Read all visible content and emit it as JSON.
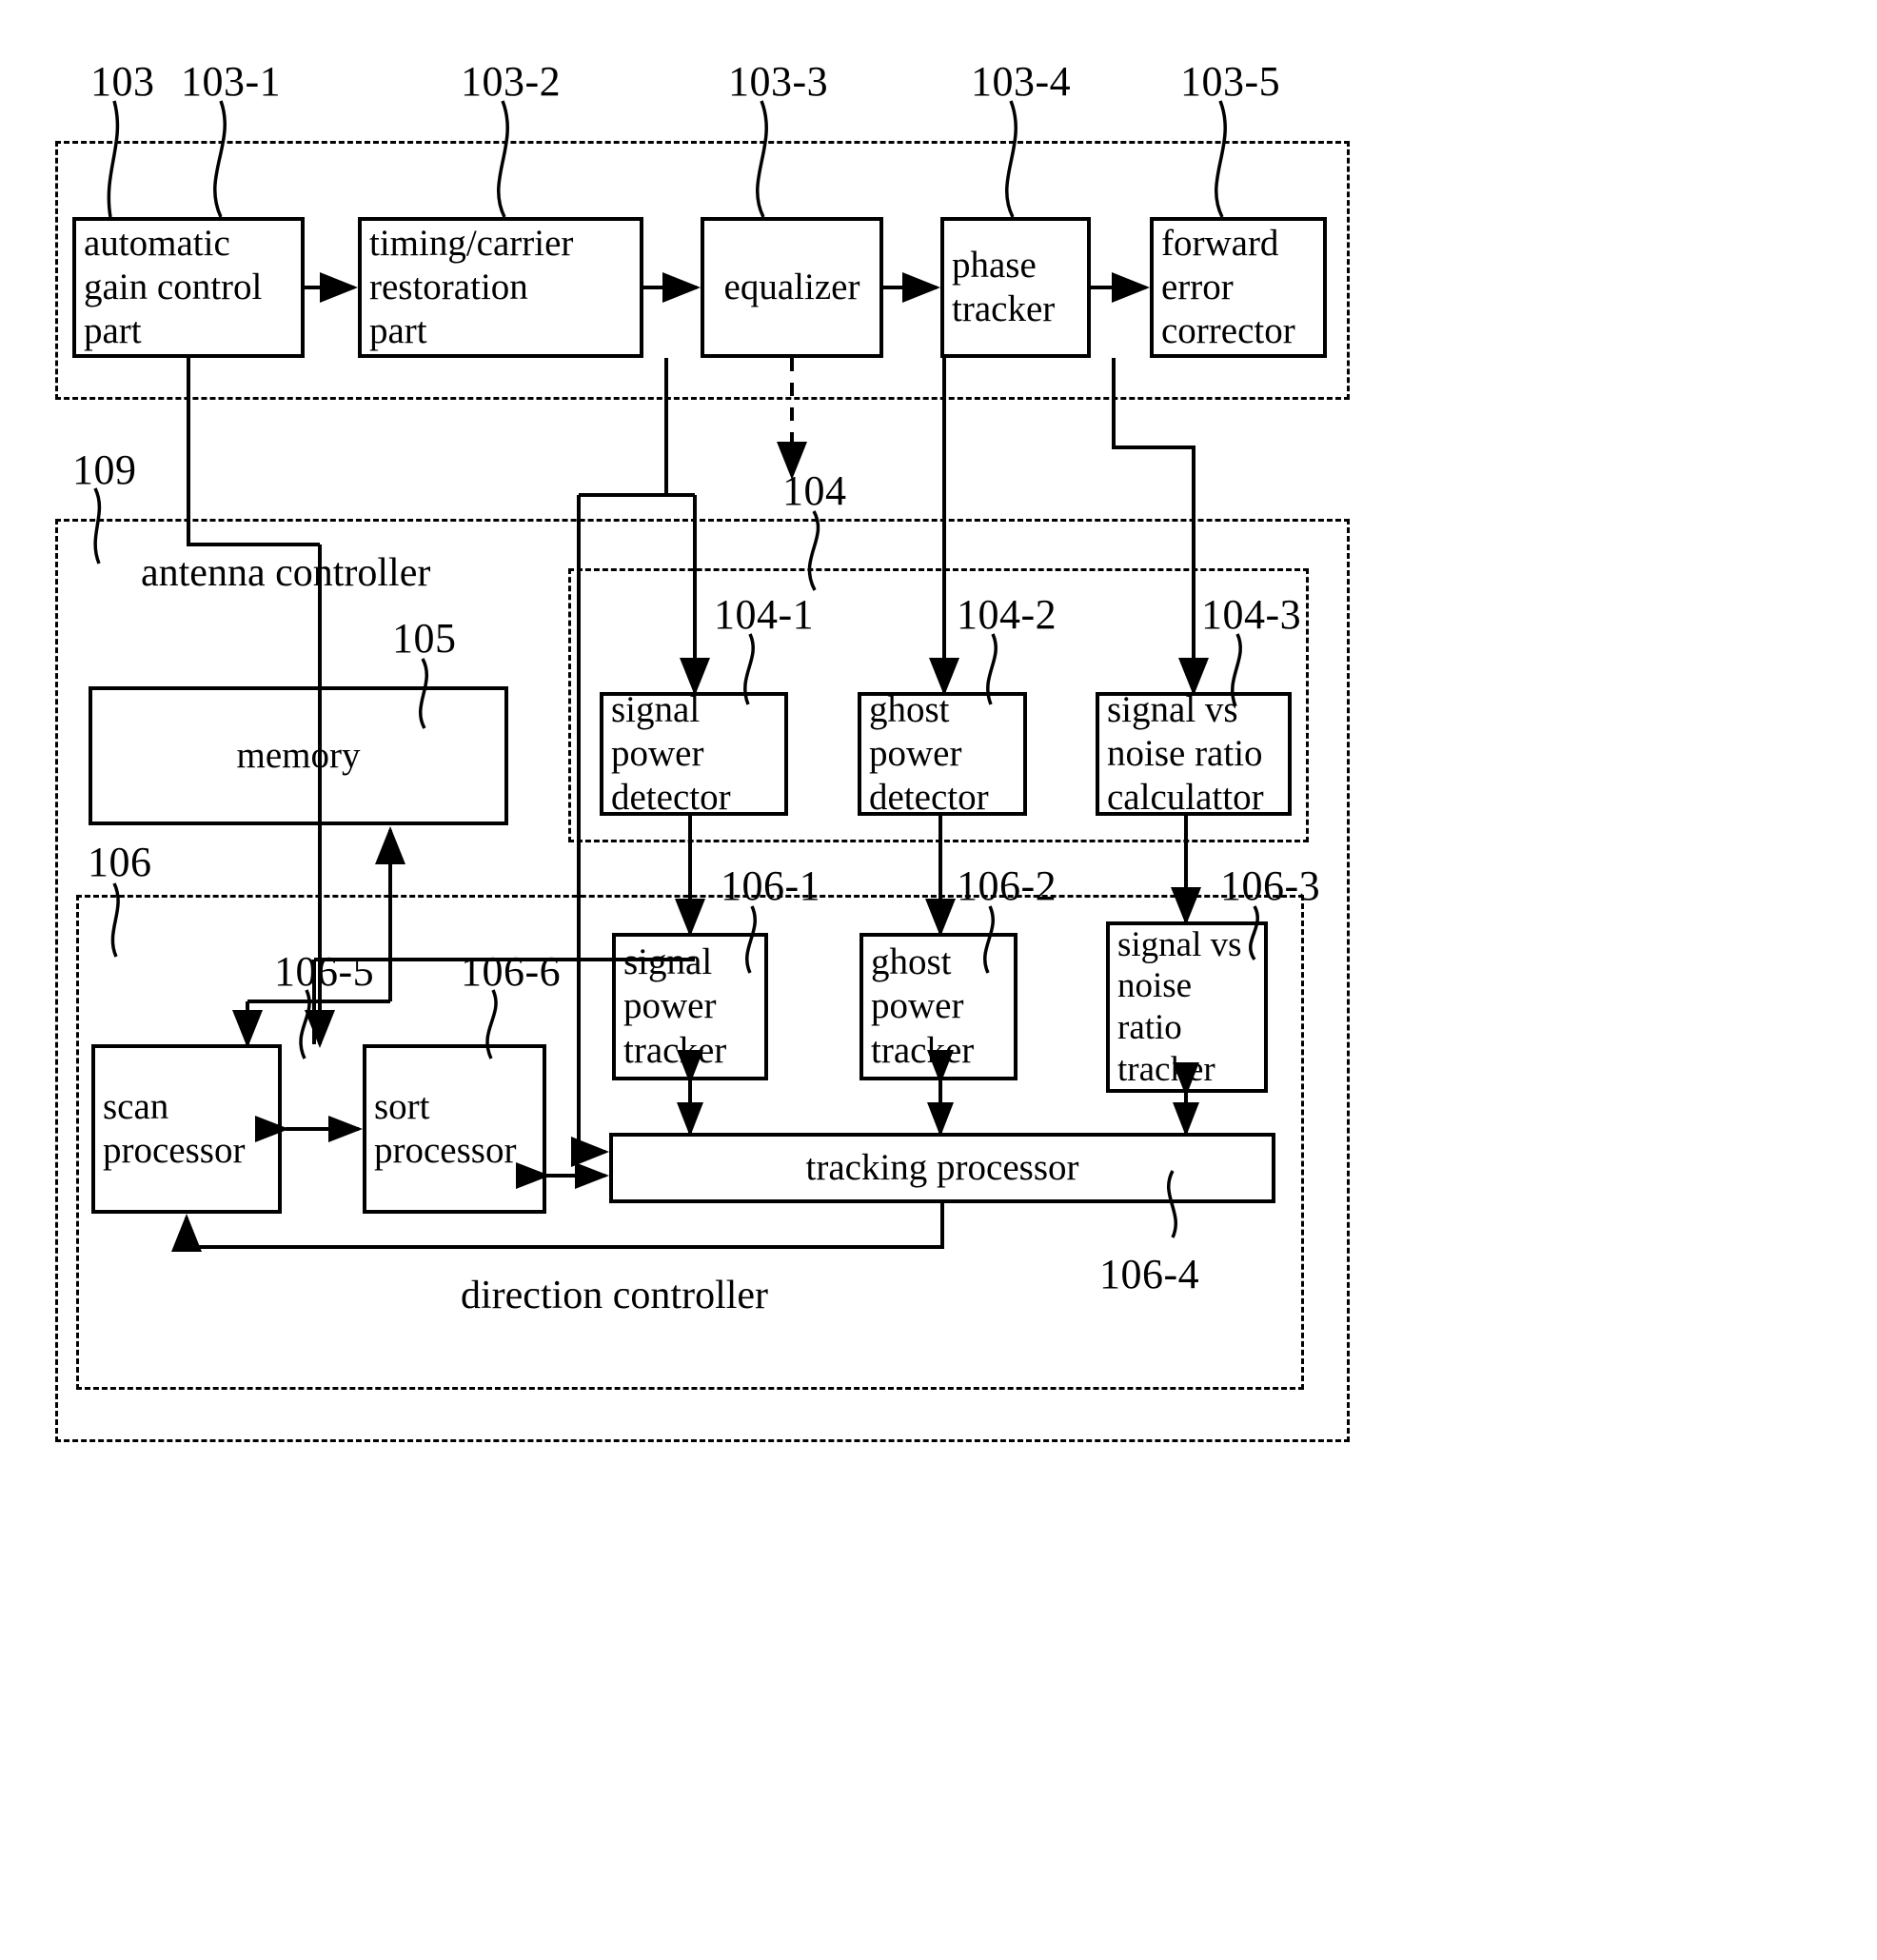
{
  "figure": {
    "type": "patent-block-diagram",
    "title": "",
    "description": "Receiver demodulation chain with antenna controller, detectors and trackers"
  },
  "groups": {
    "demodulator": {
      "ref": "103"
    },
    "detector_group": {
      "ref": "104"
    },
    "antenna_controller": {
      "ref": "109",
      "label": "antenna controller"
    },
    "direction_controller": {
      "ref": "106",
      "label": "direction controller"
    }
  },
  "blocks": {
    "agc": {
      "ref": "103-1",
      "label": "automatic\ngain control\npart"
    },
    "timing_carrier": {
      "ref": "103-2",
      "label": "timing/carrier\nrestoration\npart"
    },
    "equalizer": {
      "ref": "103-3",
      "label": "equalizer"
    },
    "phase_tracker": {
      "ref": "103-4",
      "label": "phase\ntracker"
    },
    "fec": {
      "ref": "103-5",
      "label": "forward\nerror\ncorrector"
    },
    "signal_power_detector": {
      "ref": "104-1",
      "label": "signal\npower\ndetector"
    },
    "ghost_power_detector": {
      "ref": "104-2",
      "label": "ghost\npower\ndetector"
    },
    "snr_calculator": {
      "ref": "104-3",
      "label": "signal vs\nnoise ratio\ncalculattor"
    },
    "memory": {
      "ref": "105",
      "label": "memory"
    },
    "signal_power_tracker": {
      "ref": "106-1",
      "label": "signal\npower\ntracker"
    },
    "ghost_power_tracker": {
      "ref": "106-2",
      "label": "ghost\npower\ntracker"
    },
    "snr_tracker": {
      "ref": "106-3",
      "label": "signal vs\nnoise\nratio\ntracker"
    },
    "tracking_processor": {
      "ref": "106-4",
      "label": "tracking processor"
    },
    "scan_processor": {
      "ref": "106-5",
      "label": "scan\nprocessor"
    },
    "sort_processor": {
      "ref": "106-6",
      "label": "sort\nprocessor"
    }
  },
  "reference_numerals": [
    "103",
    "103-1",
    "103-2",
    "103-3",
    "103-4",
    "103-5",
    "104",
    "104-1",
    "104-2",
    "104-3",
    "105",
    "106",
    "106-1",
    "106-2",
    "106-3",
    "106-4",
    "106-5",
    "106-6",
    "109"
  ],
  "colors": {
    "ink": "#000000",
    "paper": "#ffffff"
  }
}
